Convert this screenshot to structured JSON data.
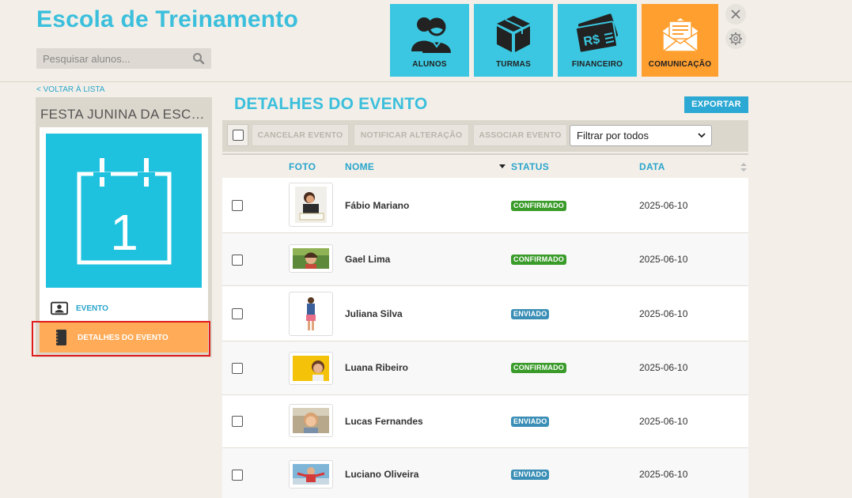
{
  "app": {
    "title": "Escola de Treinamento"
  },
  "search": {
    "placeholder": "Pesquisar alunos..."
  },
  "modules": [
    {
      "label": "ALUNOS",
      "icon": "students-icon",
      "active": false
    },
    {
      "label": "TURMAS",
      "icon": "box-icon",
      "active": false
    },
    {
      "label": "FINANCEIRO",
      "icon": "money-icon",
      "active": false
    },
    {
      "label": "COMUNICAÇÃO",
      "icon": "envelope-icon",
      "active": true
    }
  ],
  "colors": {
    "brand": "#3bbfdc",
    "module_bg": "#3bc7e1",
    "active_module": "#ff9f2f",
    "confirmado": "#3a9b2a",
    "enviado": "#3b8fb6",
    "nav_active": "#ffab57"
  },
  "back_link": "< VOLTAR À LISTA",
  "sidebar": {
    "title": "FESTA JUNINA DA ESC…",
    "calendar_day": "1",
    "nav": [
      {
        "label": "EVENTO",
        "icon": "id-card-icon"
      },
      {
        "label": "DETALHES DO EVENTO",
        "icon": "notebook-icon",
        "active": true
      }
    ]
  },
  "main": {
    "title": "DETALHES DO EVENTO",
    "export_label": "EXPORTAR",
    "toolbar": {
      "cancel_label": "CANCELAR EVENTO",
      "notify_label": "NOTIFICAR ALTERAÇÃO",
      "associate_label": "ASSOCIAR EVENTO",
      "filter_value": "Filtrar por todos"
    },
    "columns": {
      "foto": "FOTO",
      "nome": "NOME",
      "status": "STATUS",
      "data": "DATA"
    },
    "rows": [
      {
        "name": "Fábio Mariano",
        "status": "CONFIRMADO",
        "date": "2025-06-10"
      },
      {
        "name": "Gael Lima",
        "status": "CONFIRMADO",
        "date": "2025-06-10"
      },
      {
        "name": "Juliana Silva",
        "status": "ENVIADO",
        "date": "2025-06-10"
      },
      {
        "name": "Luana Ribeiro",
        "status": "CONFIRMADO",
        "date": "2025-06-10"
      },
      {
        "name": "Lucas Fernandes",
        "status": "ENVIADO",
        "date": "2025-06-10"
      },
      {
        "name": "Luciano Oliveira",
        "status": "ENVIADO",
        "date": "2025-06-10"
      }
    ]
  }
}
